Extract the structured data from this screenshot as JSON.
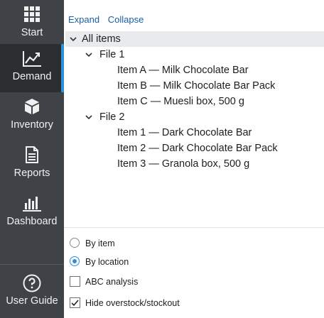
{
  "sidebar": {
    "items": [
      {
        "label": "Start",
        "icon": "grid-icon"
      },
      {
        "label": "Demand",
        "icon": "trend-chart-icon",
        "active": true
      },
      {
        "label": "Inventory",
        "icon": "box-icon"
      },
      {
        "label": "Reports",
        "icon": "document-icon"
      },
      {
        "label": "Dashboard",
        "icon": "bar-chart-icon"
      }
    ],
    "footer": {
      "label": "User Guide",
      "icon": "help-icon"
    }
  },
  "toolbar": {
    "expand_label": "Expand",
    "collapse_label": "Collapse"
  },
  "tree": {
    "root": "All items",
    "groups": [
      {
        "label": "File 1",
        "children": [
          "Item A — Milk Chocolate Bar",
          "Item B — Milk Chocolate Bar Pack",
          "Item C — Muesli box, 500 g"
        ]
      },
      {
        "label": "File 2",
        "children": [
          "Item 1 — Dark Chocolate Bar",
          "Item 2 — Dark Chocolate Bar Pack",
          "Item 3 — Granola box, 500 g"
        ]
      }
    ]
  },
  "options": {
    "by_item": {
      "label": "By item",
      "selected": false
    },
    "by_location": {
      "label": "By location",
      "selected": true
    },
    "abc_analysis": {
      "label": "ABC analysis",
      "checked": false
    },
    "hide_overstock": {
      "label": "Hide overstock/stockout",
      "checked": true
    }
  },
  "colors": {
    "accent": "#2f8fd8",
    "sidebar_bg": "#3f4347",
    "sidebar_active": "#2b2e31",
    "link": "#1a5fa8"
  }
}
